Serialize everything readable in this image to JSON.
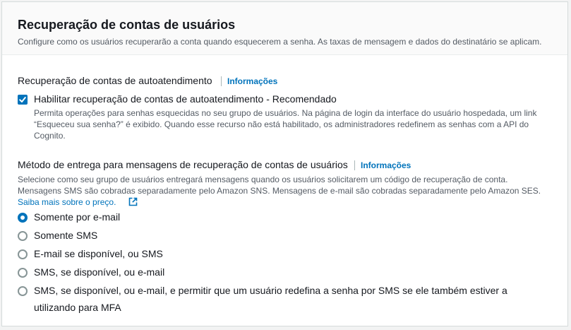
{
  "panel": {
    "title": "Recuperação de contas de usuários",
    "subtitle": "Configure como os usuários recuperarão a conta quando esquecerem a senha. As taxas de mensagem e dados do destinatário se aplicam."
  },
  "self_service": {
    "label": "Recuperação de contas de autoatendimento",
    "info": "Informações",
    "checkbox_label": "Habilitar recuperação de contas de autoatendimento - Recomendado",
    "checked": true,
    "description_lines": [
      "Permita operações para senhas esquecidas no seu grupo de usuários. Na página de login da interface do usuário hospedada, um link",
      "“Esqueceu sua senha?” é exibido. Quando esse recurso não está habilitado, os administradores redefinem as senhas com a API do",
      "Cognito."
    ]
  },
  "delivery": {
    "label": "Método de entrega para mensagens de recuperação de contas de usuários",
    "info": "Informações",
    "description_lines": [
      "Selecione como seu grupo de usuários entregará mensagens quando os usuários solicitarem um código de recuperação de conta.",
      "Mensagens SMS são cobradas separadamente pelo Amazon SNS. Mensagens de e-mail são cobradas separadamente pelo Amazon SES."
    ],
    "learn_more": "Saiba mais sobre o preço.",
    "selected_index": 0,
    "options": [
      {
        "label": "Somente por e-mail"
      },
      {
        "label": "Somente SMS"
      },
      {
        "label": "E-mail se disponível, ou SMS"
      },
      {
        "label": "SMS, se disponível, ou e-mail"
      },
      {
        "label_lines": [
          "SMS, se disponível, ou e-mail, e permitir que um usuário redefina a senha por SMS se ele também estiver a",
          "utilizando para MFA"
        ]
      }
    ]
  },
  "colors": {
    "accent": "#0073bb",
    "text": "#16191f",
    "secondary_text": "#545b64",
    "border": "#d5dbdb"
  },
  "icons": {
    "checkbox_check": "check-icon",
    "learn_more": "external-link-icon"
  }
}
